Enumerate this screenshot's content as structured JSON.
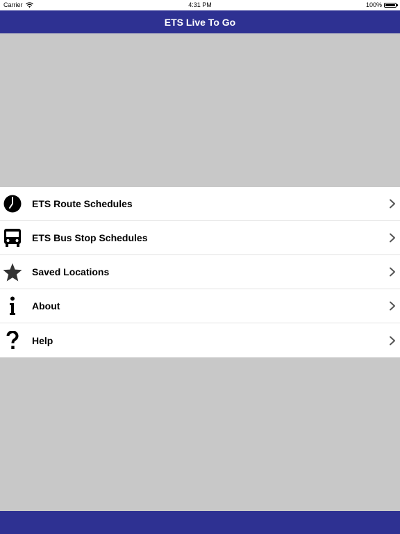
{
  "status_bar": {
    "carrier": "Carrier",
    "time": "4:31 PM",
    "battery_text": "100%",
    "battery_level": 1.0
  },
  "nav": {
    "title": "ETS Live To Go"
  },
  "colors": {
    "nav_background": "#2e3192",
    "content_background": "#c8c8c8",
    "menu_background": "#ffffff"
  },
  "menu": {
    "items": [
      {
        "label": "ETS Route Schedules",
        "icon": "clock-icon"
      },
      {
        "label": "ETS Bus Stop Schedules",
        "icon": "bus-icon"
      },
      {
        "label": "Saved Locations",
        "icon": "star-icon"
      },
      {
        "label": "About",
        "icon": "info-icon"
      },
      {
        "label": "Help",
        "icon": "question-icon"
      }
    ]
  }
}
